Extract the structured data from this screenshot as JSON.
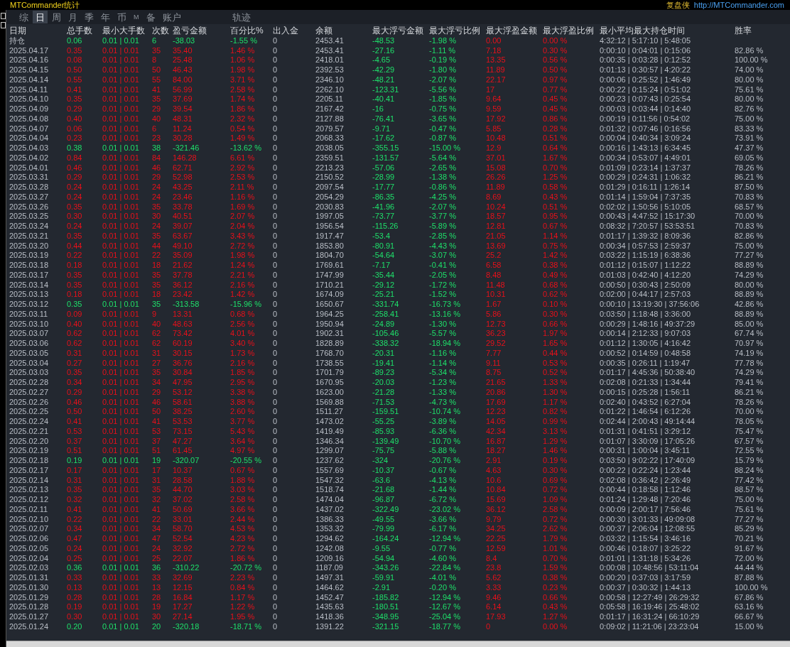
{
  "title": "MTCommander统计",
  "brand": {
    "name": "复盘侠",
    "url": "http://MTCommander.com"
  },
  "tabs": [
    {
      "label": "综",
      "selected": false
    },
    {
      "label": "日",
      "selected": true
    },
    {
      "label": "周",
      "selected": false
    },
    {
      "label": "月",
      "selected": false
    },
    {
      "label": "季",
      "selected": false
    },
    {
      "label": "年",
      "selected": false
    },
    {
      "label": "币",
      "selected": false
    },
    {
      "label": "M",
      "selected": false
    },
    {
      "label": "备",
      "selected": false
    },
    {
      "label": "账户",
      "selected": false
    }
  ],
  "right_tabs": [
    {
      "label": "轨迹",
      "selected": false
    }
  ],
  "table": {
    "columns": [
      "日期",
      "总手数",
      "最小大手数",
      "次数",
      "盈亏金额",
      "百分比%",
      "出入金",
      "余额",
      "最大浮亏金额",
      "最大浮亏比例",
      "最大浮盈金额",
      "最大浮盈比例",
      "最小平均最大持仓时间",
      "胜率"
    ],
    "rows": [
      {
        "kind": "loss",
        "cells": [
          "持仓",
          "0.06",
          "0.01 | 0.01",
          "6",
          "-38.03",
          "-1.55 %",
          "0",
          "2453.41",
          "-48.53",
          "-1.98 %",
          "0.00",
          "0.00 %",
          "4:32:12 | 5:17:10 | 5:48:05"
        ]
      },
      {
        "kind": "profit",
        "cells": [
          "2025.04.17",
          "0.35",
          "0.01 | 0.01",
          "35",
          "35.40",
          "1.46 %",
          "0",
          "2453.41",
          "-27.16",
          "-1.11 %",
          "7.18",
          "0.30 %",
          "0:00:10 | 0:04:01 | 0:15:06",
          "82.86 %"
        ]
      },
      {
        "kind": "profit",
        "cells": [
          "2025.04.16",
          "0.08",
          "0.01 | 0.01",
          "8",
          "25.48",
          "1.06 %",
          "0",
          "2418.01",
          "-4.65",
          "-0.19 %",
          "13.35",
          "0.56 %",
          "0:00:35 | 0:03:28 | 0:12:52",
          "100.00 %"
        ]
      },
      {
        "kind": "profit",
        "cells": [
          "2025.04.15",
          "0.50",
          "0.01 | 0.01",
          "50",
          "46.43",
          "1.98 %",
          "0",
          "2392.53",
          "-42.29",
          "-1.80 %",
          "11.89",
          "0.50 %",
          "0:01:13 | 0:30:57 | 4:20:22",
          "74.00 %"
        ]
      },
      {
        "kind": "profit",
        "cells": [
          "2025.04.14",
          "0.55",
          "0.01 | 0.01",
          "55",
          "84.00",
          "3.71 %",
          "0",
          "2346.10",
          "-48.21",
          "-2.07 %",
          "22.17",
          "0.97 %",
          "0:00:06 | 0:25:52 | 1:46:49",
          "80.00 %"
        ]
      },
      {
        "kind": "profit",
        "cells": [
          "2025.04.11",
          "0.41",
          "0.01 | 0.01",
          "41",
          "56.99",
          "2.58 %",
          "0",
          "2262.10",
          "-123.31",
          "-5.56 %",
          "17",
          "0.77 %",
          "0:00:22 | 0:15:24 | 0:51:02",
          "75.61 %"
        ]
      },
      {
        "kind": "profit",
        "cells": [
          "2025.04.10",
          "0.35",
          "0.01 | 0.01",
          "35",
          "37.69",
          "1.74 %",
          "0",
          "2205.11",
          "-40.41",
          "-1.85 %",
          "9.64",
          "0.45 %",
          "0:00:23 | 0:07:43 | 0:25:54",
          "80.00 %"
        ]
      },
      {
        "kind": "profit",
        "cells": [
          "2025.04.09",
          "0.29",
          "0.01 | 0.01",
          "29",
          "39.54",
          "1.86 %",
          "0",
          "2167.42",
          "-16",
          "-0.75 %",
          "9.59",
          "0.45 %",
          "0:00:03 | 0:03:44 | 0:14:40",
          "82.76 %"
        ]
      },
      {
        "kind": "profit",
        "cells": [
          "2025.04.08",
          "0.40",
          "0.01 | 0.01",
          "40",
          "48.31",
          "2.32 %",
          "0",
          "2127.88",
          "-76.41",
          "-3.65 %",
          "17.92",
          "0.86 %",
          "0:00:19 | 0:11:56 | 0:54:02",
          "75.00 %"
        ]
      },
      {
        "kind": "profit",
        "cells": [
          "2025.04.07",
          "0.06",
          "0.01 | 0.01",
          "6",
          "11.24",
          "0.54 %",
          "0",
          "2079.57",
          "-9.71",
          "-0.47 %",
          "5.85",
          "0.28 %",
          "0:01:32 | 0:07:46 | 0:16:56",
          "83.33 %"
        ]
      },
      {
        "kind": "profit",
        "cells": [
          "2025.04.04",
          "0.23",
          "0.01 | 0.01",
          "23",
          "30.28",
          "1.49 %",
          "0",
          "2068.33",
          "-17.62",
          "-0.87 %",
          "10.48",
          "0.51 %",
          "0:00:04 | 0:40:34 | 3:09:24",
          "73.91 %"
        ]
      },
      {
        "kind": "loss",
        "cells": [
          "2025.04.03",
          "0.38",
          "0.01 | 0.01",
          "38",
          "-321.46",
          "-13.62 %",
          "0",
          "2038.05",
          "-355.15",
          "-15.00 %",
          "12.9",
          "0.64 %",
          "0:00:16 | 1:43:13 | 6:34:45",
          "47.37 %"
        ]
      },
      {
        "kind": "profit",
        "cells": [
          "2025.04.02",
          "0.84",
          "0.01 | 0.01",
          "84",
          "146.28",
          "6.61 %",
          "0",
          "2359.51",
          "-131.57",
          "-5.64 %",
          "37.01",
          "1.67 %",
          "0:00:34 | 0:53:07 | 4:49:01",
          "69.05 %"
        ]
      },
      {
        "kind": "profit",
        "cells": [
          "2025.04.01",
          "0.46",
          "0.01 | 0.01",
          "46",
          "62.71",
          "2.92 %",
          "0",
          "2213.23",
          "-57.06",
          "-2.65 %",
          "15.08",
          "0.70 %",
          "0:01:09 | 0:23:14 | 1:37:37",
          "78.26 %"
        ]
      },
      {
        "kind": "profit",
        "cells": [
          "2025.03.31",
          "0.29",
          "0.01 | 0.01",
          "29",
          "52.98",
          "2.53 %",
          "0",
          "2150.52",
          "-28.99",
          "-1.38 %",
          "26.26",
          "1.25 %",
          "0:00:29 | 0:24:31 | 1:06:32",
          "86.21 %"
        ]
      },
      {
        "kind": "profit",
        "cells": [
          "2025.03.28",
          "0.24",
          "0.01 | 0.01",
          "24",
          "43.25",
          "2.11 %",
          "0",
          "2097.54",
          "-17.77",
          "-0.86 %",
          "11.89",
          "0.58 %",
          "0:01:29 | 0:16:11 | 1:26:14",
          "87.50 %"
        ]
      },
      {
        "kind": "profit",
        "cells": [
          "2025.03.27",
          "0.24",
          "0.01 | 0.01",
          "24",
          "23.46",
          "1.16 %",
          "0",
          "2054.29",
          "-86.35",
          "-4.25 %",
          "8.69",
          "0.43 %",
          "0:01:14 | 1:59:04 | 7:37:35",
          "70.83 %"
        ]
      },
      {
        "kind": "profit",
        "cells": [
          "2025.03.26",
          "0.35",
          "0.01 | 0.01",
          "35",
          "33.78",
          "1.69 %",
          "0",
          "2030.83",
          "-41.96",
          "-2.07 %",
          "10.24",
          "0.51 %",
          "0:02:02 | 1:50:56 | 5:10:05",
          "68.57 %"
        ]
      },
      {
        "kind": "profit",
        "cells": [
          "2025.03.25",
          "0.30",
          "0.01 | 0.01",
          "30",
          "40.51",
          "2.07 %",
          "0",
          "1997.05",
          "-73.77",
          "-3.77 %",
          "18.57",
          "0.95 %",
          "0:00:43 | 4:47:52 | 15:17:30",
          "70.00 %"
        ]
      },
      {
        "kind": "profit",
        "cells": [
          "2025.03.24",
          "0.24",
          "0.01 | 0.01",
          "24",
          "39.07",
          "2.04 %",
          "0",
          "1956.54",
          "-115.26",
          "-5.89 %",
          "12.81",
          "0.67 %",
          "0:08:32 | 7:20:57 | 53:53:51",
          "70.83 %"
        ]
      },
      {
        "kind": "profit",
        "cells": [
          "2025.03.21",
          "0.35",
          "0.01 | 0.01",
          "35",
          "63.67",
          "3.43 %",
          "0",
          "1917.47",
          "-53.4",
          "-2.85 %",
          "21.05",
          "1.14 %",
          "0:01:17 | 1:39:32 | 8:09:36",
          "82.86 %"
        ]
      },
      {
        "kind": "profit",
        "cells": [
          "2025.03.20",
          "0.44",
          "0.01 | 0.01",
          "44",
          "49.10",
          "2.72 %",
          "0",
          "1853.80",
          "-80.91",
          "-4.43 %",
          "13.69",
          "0.75 %",
          "0:00:34 | 0:57:53 | 2:59:37",
          "75.00 %"
        ]
      },
      {
        "kind": "profit",
        "cells": [
          "2025.03.19",
          "0.22",
          "0.01 | 0.01",
          "22",
          "35.09",
          "1.98 %",
          "0",
          "1804.70",
          "-54.64",
          "-3.07 %",
          "25.2",
          "1.42 %",
          "0:03:22 | 1:15:19 | 6:38:36",
          "77.27 %"
        ]
      },
      {
        "kind": "profit",
        "cells": [
          "2025.03.18",
          "0.18",
          "0.01 | 0.01",
          "18",
          "21.62",
          "1.24 %",
          "0",
          "1769.61",
          "-7.17",
          "-0.41 %",
          "6.58",
          "0.38 %",
          "0:01:12 | 0:15:07 | 1:12:22",
          "88.89 %"
        ]
      },
      {
        "kind": "profit",
        "cells": [
          "2025.03.17",
          "0.35",
          "0.01 | 0.01",
          "35",
          "37.78",
          "2.21 %",
          "0",
          "1747.99",
          "-35.44",
          "-2.05 %",
          "8.48",
          "0.49 %",
          "0:01:03 | 0:42:40 | 4:12:20",
          "74.29 %"
        ]
      },
      {
        "kind": "profit",
        "cells": [
          "2025.03.14",
          "0.35",
          "0.01 | 0.01",
          "35",
          "36.12",
          "2.16 %",
          "0",
          "1710.21",
          "-29.12",
          "-1.72 %",
          "11.48",
          "0.68 %",
          "0:00:50 | 0:30:43 | 2:50:09",
          "80.00 %"
        ]
      },
      {
        "kind": "profit",
        "cells": [
          "2025.03.13",
          "0.18",
          "0.01 | 0.01",
          "18",
          "23.42",
          "1.42 %",
          "0",
          "1674.09",
          "-25.21",
          "-1.52 %",
          "10.31",
          "0.62 %",
          "0:02:00 | 0:44:17 | 2:57:03",
          "88.89 %"
        ]
      },
      {
        "kind": "loss",
        "cells": [
          "2025.03.12",
          "0.35",
          "0.01 | 0.01",
          "35",
          "-313.58",
          "-15.96 %",
          "0",
          "1650.67",
          "-331.74",
          "-16.73 %",
          "1.67",
          "0.10 %",
          "0:00:10 | 13:19:30 | 37:56:06",
          "42.86 %"
        ]
      },
      {
        "kind": "profit",
        "cells": [
          "2025.03.11",
          "0.09",
          "0.01 | 0.01",
          "9",
          "13.31",
          "0.68 %",
          "0",
          "1964.25",
          "-258.41",
          "-13.16 %",
          "5.86",
          "0.30 %",
          "0:03:50 | 1:18:48 | 3:36:00",
          "88.89 %"
        ]
      },
      {
        "kind": "profit",
        "cells": [
          "2025.03.10",
          "0.40",
          "0.01 | 0.01",
          "40",
          "48.63",
          "2.56 %",
          "0",
          "1950.94",
          "-24.89",
          "-1.30 %",
          "12.73",
          "0.66 %",
          "0:00:29 | 1:48:16 | 49:37:29",
          "85.00 %"
        ]
      },
      {
        "kind": "profit",
        "cells": [
          "2025.03.07",
          "0.62",
          "0.01 | 0.01",
          "62",
          "73.42",
          "4.01 %",
          "0",
          "1902.31",
          "-105.46",
          "-5.57 %",
          "36.23",
          "1.97 %",
          "0:00:14 | 2:12:33 | 9:07:03",
          "67.74 %"
        ]
      },
      {
        "kind": "profit",
        "cells": [
          "2025.03.06",
          "0.62",
          "0.01 | 0.01",
          "62",
          "60.19",
          "3.40 %",
          "0",
          "1828.89",
          "-338.32",
          "-18.94 %",
          "29.52",
          "1.65 %",
          "0:01:12 | 1:30:05 | 4:16:42",
          "70.97 %"
        ]
      },
      {
        "kind": "profit",
        "cells": [
          "2025.03.05",
          "0.31",
          "0.01 | 0.01",
          "31",
          "30.15",
          "1.73 %",
          "0",
          "1768.70",
          "-20.31",
          "-1.16 %",
          "7.77",
          "0.44 %",
          "0:00:52 | 0:14:59 | 0:48:58",
          "74.19 %"
        ]
      },
      {
        "kind": "profit",
        "cells": [
          "2025.03.04",
          "0.27",
          "0.01 | 0.01",
          "27",
          "36.76",
          "2.16 %",
          "0",
          "1738.55",
          "-19.41",
          "-1.14 %",
          "9.11",
          "0.53 %",
          "0:00:35 | 0:26:11 | 1:19:47",
          "77.78 %"
        ]
      },
      {
        "kind": "profit",
        "cells": [
          "2025.03.03",
          "0.35",
          "0.01 | 0.01",
          "35",
          "30.84",
          "1.85 %",
          "0",
          "1701.79",
          "-89.23",
          "-5.34 %",
          "8.75",
          "0.52 %",
          "0:01:17 | 4:45:36 | 50:38:40",
          "74.29 %"
        ]
      },
      {
        "kind": "profit",
        "cells": [
          "2025.02.28",
          "0.34",
          "0.01 | 0.01",
          "34",
          "47.95",
          "2.95 %",
          "0",
          "1670.95",
          "-20.03",
          "-1.23 %",
          "21.65",
          "1.33 %",
          "0:02:08 | 0:21:33 | 1:34:44",
          "79.41 %"
        ]
      },
      {
        "kind": "profit",
        "cells": [
          "2025.02.27",
          "0.29",
          "0.01 | 0.01",
          "29",
          "53.12",
          "3.38 %",
          "0",
          "1623.00",
          "-21.28",
          "-1.33 %",
          "20.86",
          "1.30 %",
          "0:00:15 | 0:25:28 | 1:56:11",
          "86.21 %"
        ]
      },
      {
        "kind": "profit",
        "cells": [
          "2025.02.26",
          "0.46",
          "0.01 | 0.01",
          "46",
          "58.61",
          "3.88 %",
          "0",
          "1569.88",
          "-71.53",
          "-4.73 %",
          "17.69",
          "1.17 %",
          "0:02:40 | 0:43:52 | 6:27:04",
          "78.26 %"
        ]
      },
      {
        "kind": "profit",
        "cells": [
          "2025.02.25",
          "0.50",
          "0.01 | 0.01",
          "50",
          "38.25",
          "2.60 %",
          "0",
          "1511.27",
          "-159.51",
          "-10.74 %",
          "12.23",
          "0.82 %",
          "0:01:22 | 1:46:54 | 6:12:26",
          "70.00 %"
        ]
      },
      {
        "kind": "profit",
        "cells": [
          "2025.02.24",
          "0.41",
          "0.01 | 0.01",
          "41",
          "53.53",
          "3.77 %",
          "0",
          "1473.02",
          "-55.25",
          "-3.89 %",
          "14.05",
          "0.99 %",
          "0:02:44 | 2:00:43 | 49:14:44",
          "78.05 %"
        ]
      },
      {
        "kind": "profit",
        "cells": [
          "2025.02.21",
          "0.53",
          "0.01 | 0.01",
          "53",
          "73.15",
          "5.43 %",
          "0",
          "1419.49",
          "-85.93",
          "-6.36 %",
          "42.34",
          "3.13 %",
          "0:01:31 | 0:41:51 | 3:29:12",
          "75.47 %"
        ]
      },
      {
        "kind": "profit",
        "cells": [
          "2025.02.20",
          "0.37",
          "0.01 | 0.01",
          "37",
          "47.27",
          "3.64 %",
          "0",
          "1346.34",
          "-139.49",
          "-10.70 %",
          "16.87",
          "1.29 %",
          "0:01:07 | 3:30:09 | 17:05:26",
          "67.57 %"
        ]
      },
      {
        "kind": "profit",
        "cells": [
          "2025.02.19",
          "0.51",
          "0.01 | 0.01",
          "51",
          "61.45",
          "4.97 %",
          "0",
          "1299.07",
          "-75.75",
          "-5.88 %",
          "18.27",
          "1.46 %",
          "0:00:31 | 1:00:04 | 3:45:11",
          "72.55 %"
        ]
      },
      {
        "kind": "loss",
        "cells": [
          "2025.02.18",
          "0.19",
          "0.01 | 0.01",
          "19",
          "-320.07",
          "-20.55 %",
          "0",
          "1237.62",
          "-324",
          "-20.76 %",
          "2.91",
          "0.19 %",
          "0:03:50 | 9:02:22 | 17:40:09",
          "15.79 %"
        ]
      },
      {
        "kind": "profit",
        "cells": [
          "2025.02.17",
          "0.17",
          "0.01 | 0.01",
          "17",
          "10.37",
          "0.67 %",
          "0",
          "1557.69",
          "-10.37",
          "-0.67 %",
          "4.63",
          "0.30 %",
          "0:00:22 | 0:22:24 | 1:23:44",
          "88.24 %"
        ]
      },
      {
        "kind": "profit",
        "cells": [
          "2025.02.14",
          "0.31",
          "0.01 | 0.01",
          "31",
          "28.58",
          "1.88 %",
          "0",
          "1547.32",
          "-63.6",
          "-4.13 %",
          "10.6",
          "0.69 %",
          "0:02:08 | 0:36:42 | 2:26:49",
          "77.42 %"
        ]
      },
      {
        "kind": "profit",
        "cells": [
          "2025.02.13",
          "0.35",
          "0.01 | 0.01",
          "35",
          "44.70",
          "3.03 %",
          "0",
          "1518.74",
          "-21.68",
          "-1.44 %",
          "10.84",
          "0.72 %",
          "0:00:44 | 0:18:58 | 1:12:46",
          "88.57 %"
        ]
      },
      {
        "kind": "profit",
        "cells": [
          "2025.02.12",
          "0.32",
          "0.01 | 0.01",
          "32",
          "37.02",
          "2.58 %",
          "0",
          "1474.04",
          "-96.87",
          "-6.72 %",
          "15.69",
          "1.09 %",
          "0:01:24 | 1:29:48 | 7:20:46",
          "75.00 %"
        ]
      },
      {
        "kind": "profit",
        "cells": [
          "2025.02.11",
          "0.41",
          "0.01 | 0.01",
          "41",
          "50.69",
          "3.66 %",
          "0",
          "1437.02",
          "-322.49",
          "-23.02 %",
          "36.12",
          "2.58 %",
          "0:00:09 | 2:00:17 | 7:56:46",
          "75.61 %"
        ]
      },
      {
        "kind": "profit",
        "cells": [
          "2025.02.10",
          "0.22",
          "0.01 | 0.01",
          "22",
          "33.01",
          "2.44 %",
          "0",
          "1386.33",
          "-49.55",
          "-3.66 %",
          "9.79",
          "0.72 %",
          "0:00:30 | 3:01:33 | 49:09:08",
          "77.27 %"
        ]
      },
      {
        "kind": "profit",
        "cells": [
          "2025.02.07",
          "0.34",
          "0.01 | 0.01",
          "34",
          "58.70",
          "4.53 %",
          "0",
          "1353.32",
          "-79.99",
          "-6.17 %",
          "34.25",
          "2.62 %",
          "0:00:37 | 2:06:04 | 12:08:55",
          "85.29 %"
        ]
      },
      {
        "kind": "profit",
        "cells": [
          "2025.02.06",
          "0.47",
          "0.01 | 0.01",
          "47",
          "52.54",
          "4.23 %",
          "0",
          "1294.62",
          "-164.24",
          "-12.94 %",
          "22.25",
          "1.79 %",
          "0:03:32 | 1:15:54 | 3:46:16",
          "70.21 %"
        ]
      },
      {
        "kind": "profit",
        "cells": [
          "2025.02.05",
          "0.24",
          "0.01 | 0.01",
          "24",
          "32.92",
          "2.72 %",
          "0",
          "1242.08",
          "-9.55",
          "-0.77 %",
          "12.59",
          "1.01 %",
          "0:00:46 | 0:18:07 | 3:25:22",
          "91.67 %"
        ]
      },
      {
        "kind": "profit",
        "cells": [
          "2025.02.04",
          "0.25",
          "0.01 | 0.01",
          "25",
          "22.07",
          "1.86 %",
          "0",
          "1209.16",
          "-54.94",
          "-4.60 %",
          "8.4",
          "0.70 %",
          "0:01:01 | 1:31:18 | 5:34:26",
          "72.00 %"
        ]
      },
      {
        "kind": "loss",
        "cells": [
          "2025.02.03",
          "0.36",
          "0.01 | 0.01",
          "36",
          "-310.22",
          "-20.72 %",
          "0",
          "1187.09",
          "-343.26",
          "-22.84 %",
          "23.8",
          "1.59 %",
          "0:00:08 | 10:48:56 | 53:11:04",
          "44.44 %"
        ]
      },
      {
        "kind": "profit",
        "cells": [
          "2025.01.31",
          "0.33",
          "0.01 | 0.01",
          "33",
          "32.69",
          "2.23 %",
          "0",
          "1497.31",
          "-59.91",
          "-4.01 %",
          "5.62",
          "0.38 %",
          "0:00:20 | 0:37:03 | 3:17:59",
          "87.88 %"
        ]
      },
      {
        "kind": "profit",
        "cells": [
          "2025.01.30",
          "0.13",
          "0.01 | 0.01",
          "13",
          "12.15",
          "0.84 %",
          "0",
          "1464.62",
          "-2.91",
          "-0.20 %",
          "3.33",
          "0.23 %",
          "0:00:37 | 0:30:32 | 1:44:13",
          "100.00 %"
        ]
      },
      {
        "kind": "profit",
        "cells": [
          "2025.01.29",
          "0.28",
          "0.01 | 0.01",
          "28",
          "16.84",
          "1.17 %",
          "0",
          "1452.47",
          "-185.82",
          "-12.94 %",
          "9.46",
          "0.66 %",
          "0:00:58 | 12:27:49 | 26:29:32",
          "67.86 %"
        ]
      },
      {
        "kind": "profit",
        "cells": [
          "2025.01.28",
          "0.19",
          "0.01 | 0.01",
          "19",
          "17.27",
          "1.22 %",
          "0",
          "1435.63",
          "-180.51",
          "-12.67 %",
          "6.14",
          "0.43 %",
          "0:05:58 | 16:19:46 | 25:48:02",
          "63.16 %"
        ]
      },
      {
        "kind": "profit",
        "cells": [
          "2025.01.27",
          "0.30",
          "0.01 | 0.01",
          "30",
          "27.14",
          "1.95 %",
          "0",
          "1418.36",
          "-348.95",
          "-25.04 %",
          "17.93",
          "1.27 %",
          "0:01:17 | 16:31:24 | 66:10:29",
          "66.67 %"
        ]
      },
      {
        "kind": "loss",
        "cells": [
          "2025.01.24",
          "0.20",
          "0.01 | 0.01",
          "20",
          "-320.18",
          "-18.71 %",
          "0",
          "1391.22",
          "-321.15",
          "-18.77 %",
          "0",
          "0.00 %",
          "0:09:02 | 11:21:06 | 23:23:04",
          "15.00 %"
        ]
      }
    ]
  }
}
